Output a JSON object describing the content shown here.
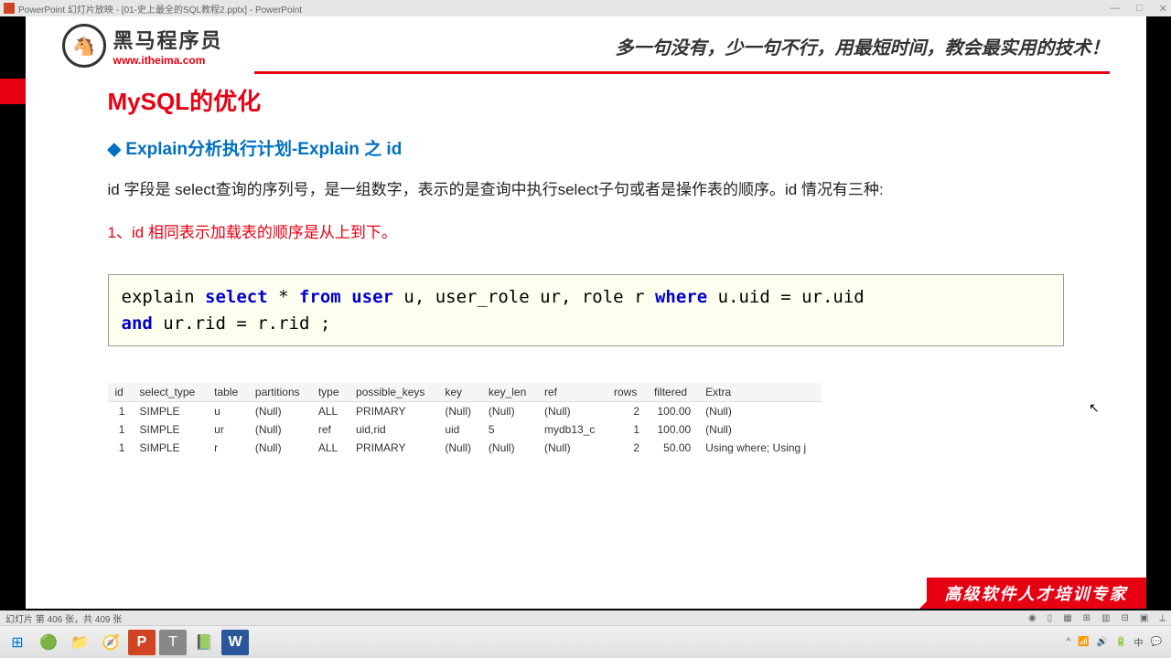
{
  "window": {
    "title": "PowerPoint 幻灯片放映 - [01-史上最全的SQL教程2.pptx] - PowerPoint",
    "min": "—",
    "max": "□",
    "close": "✕"
  },
  "header": {
    "logo_cn": "黑马程序员",
    "logo_url": "www.itheima.com",
    "slogan": "多一句没有，少一句不行，用最短时间，教会最实用的技术！"
  },
  "content": {
    "main_title": "MySQL的优化",
    "sub_title": "Explain分析执行计划-Explain 之 id",
    "desc": "id 字段是 select查询的序列号，是一组数字，表示的是查询中执行select子句或者是操作表的顺序。id 情况有三种:",
    "red_note": "1、id 相同表示加载表的顺序是从上到下。"
  },
  "code": {
    "t1": "explain ",
    "kw_select": "select",
    "t2": " * ",
    "kw_from": "from",
    "t3": " ",
    "kw_user": "user",
    "t4": " u, user_role ur, role r ",
    "kw_where": "where",
    "t5": " u.uid = ur.uid ",
    "kw_and": "and",
    "t6": " ur.rid = r.rid ;"
  },
  "table": {
    "headers": [
      "id",
      "select_type",
      "table",
      "partitions",
      "type",
      "possible_keys",
      "key",
      "key_len",
      "ref",
      "rows",
      "filtered",
      "Extra"
    ],
    "rows": [
      {
        "id": "1",
        "select_type": "SIMPLE",
        "table": "u",
        "partitions": "(Null)",
        "type": "ALL",
        "possible_keys": "PRIMARY",
        "key": "(Null)",
        "key_len": "(Null)",
        "ref": "(Null)",
        "rows": "2",
        "filtered": "100.00",
        "extra": "(Null)"
      },
      {
        "id": "1",
        "select_type": "SIMPLE",
        "table": "ur",
        "partitions": "(Null)",
        "type": "ref",
        "possible_keys": "uid,rid",
        "key": "uid",
        "key_len": "5",
        "ref": "mydb13_c",
        "rows": "1",
        "filtered": "100.00",
        "extra": "(Null)"
      },
      {
        "id": "1",
        "select_type": "SIMPLE",
        "table": "r",
        "partitions": "(Null)",
        "type": "ALL",
        "possible_keys": "PRIMARY",
        "key": "(Null)",
        "key_len": "(Null)",
        "ref": "(Null)",
        "rows": "2",
        "filtered": "50.00",
        "extra": "Using where; Using j"
      }
    ]
  },
  "footer_banner": "高级软件人才培训专家",
  "status": {
    "text": "幻灯片 第 406 张，共 409 张"
  },
  "taskbar": {
    "time": "",
    "items": [
      "⊞",
      "🌐",
      "📁",
      "🧭",
      "P",
      "T",
      "📊",
      "W"
    ]
  }
}
